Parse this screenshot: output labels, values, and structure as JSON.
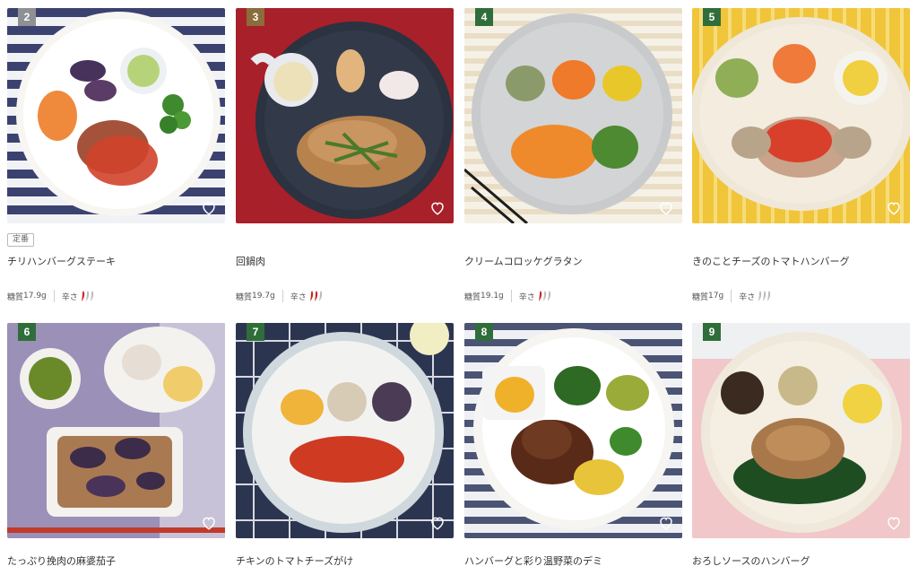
{
  "colors": {
    "rank_green": "#2f6e3a",
    "chili_red": "#c8281e",
    "chili_gray": "#bdbdbd",
    "heart": "#ffffff"
  },
  "labels": {
    "carb_prefix": "糖質",
    "spice_label": "辛さ"
  },
  "products": [
    {
      "rank": "2",
      "badge": "定番",
      "name": "チリハンバーグステーキ",
      "carb": "17.9g",
      "spice_level": 1,
      "spice_max": 3
    },
    {
      "rank": "3",
      "name": "回鍋肉",
      "carb": "19.7g",
      "spice_level": 2,
      "spice_max": 3
    },
    {
      "rank": "4",
      "name": "クリームコロッケグラタン",
      "carb": "19.1g",
      "spice_level": 1,
      "spice_max": 3
    },
    {
      "rank": "5",
      "name": "きのことチーズのトマトハンバーグ",
      "carb": "17g",
      "spice_level": 0,
      "spice_max": 3
    },
    {
      "rank": "6",
      "name": "たっぷり挽肉の麻婆茄子"
    },
    {
      "rank": "7",
      "name": "チキンのトマトチーズがけ"
    },
    {
      "rank": "8",
      "name": "ハンバーグと彩り温野菜のデミ"
    },
    {
      "rank": "9",
      "name": "おろしソースのハンバーグ"
    }
  ]
}
